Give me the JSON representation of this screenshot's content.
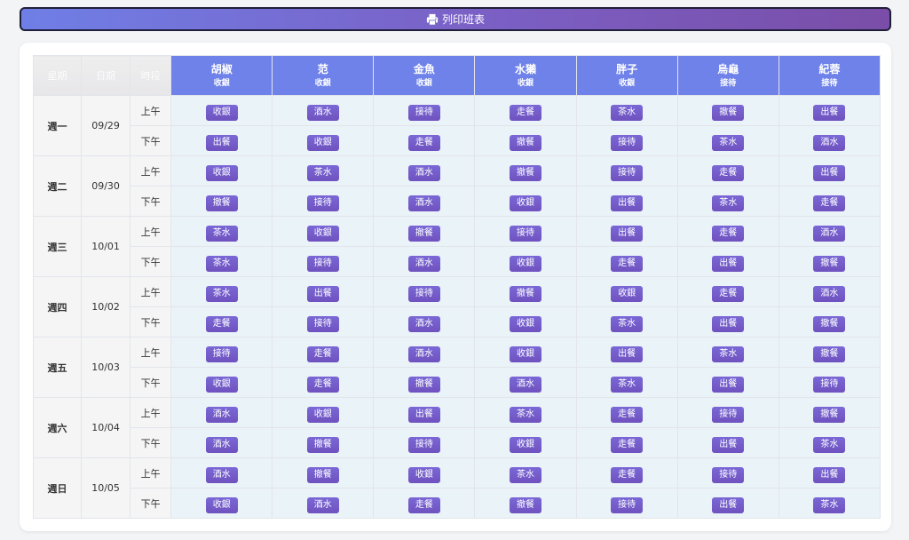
{
  "toolbar": {
    "print_label": "列印班表",
    "print_icon": "printer-icon"
  },
  "columns": {
    "day": "星期",
    "date": "日期",
    "period": "時段"
  },
  "employees": [
    {
      "name": "胡椒",
      "role": "收銀"
    },
    {
      "name": "范",
      "role": "收銀"
    },
    {
      "name": "金魚",
      "role": "收銀"
    },
    {
      "name": "水獺",
      "role": "收銀"
    },
    {
      "name": "胖子",
      "role": "收銀"
    },
    {
      "name": "烏龜",
      "role": "接待"
    },
    {
      "name": "紀蓉",
      "role": "接待"
    }
  ],
  "days": [
    {
      "day": "週一",
      "date": "09/29",
      "shifts": [
        {
          "period": "上午",
          "tasks": [
            "收銀",
            "酒水",
            "接待",
            "走餐",
            "茶水",
            "撤餐",
            "出餐"
          ]
        },
        {
          "period": "下午",
          "tasks": [
            "出餐",
            "收銀",
            "走餐",
            "撤餐",
            "接待",
            "茶水",
            "酒水"
          ]
        }
      ]
    },
    {
      "day": "週二",
      "date": "09/30",
      "shifts": [
        {
          "period": "上午",
          "tasks": [
            "收銀",
            "茶水",
            "酒水",
            "撤餐",
            "接待",
            "走餐",
            "出餐"
          ]
        },
        {
          "period": "下午",
          "tasks": [
            "撤餐",
            "接待",
            "酒水",
            "收銀",
            "出餐",
            "茶水",
            "走餐"
          ]
        }
      ]
    },
    {
      "day": "週三",
      "date": "10/01",
      "shifts": [
        {
          "period": "上午",
          "tasks": [
            "茶水",
            "收銀",
            "撤餐",
            "接待",
            "出餐",
            "走餐",
            "酒水"
          ]
        },
        {
          "period": "下午",
          "tasks": [
            "茶水",
            "接待",
            "酒水",
            "收銀",
            "走餐",
            "出餐",
            "撤餐"
          ]
        }
      ]
    },
    {
      "day": "週四",
      "date": "10/02",
      "shifts": [
        {
          "period": "上午",
          "tasks": [
            "茶水",
            "出餐",
            "接待",
            "撤餐",
            "收銀",
            "走餐",
            "酒水"
          ]
        },
        {
          "period": "下午",
          "tasks": [
            "走餐",
            "接待",
            "酒水",
            "收銀",
            "茶水",
            "出餐",
            "撤餐"
          ]
        }
      ]
    },
    {
      "day": "週五",
      "date": "10/03",
      "shifts": [
        {
          "period": "上午",
          "tasks": [
            "接待",
            "走餐",
            "酒水",
            "收銀",
            "出餐",
            "茶水",
            "撤餐"
          ]
        },
        {
          "period": "下午",
          "tasks": [
            "收銀",
            "走餐",
            "撤餐",
            "酒水",
            "茶水",
            "出餐",
            "接待"
          ]
        }
      ]
    },
    {
      "day": "週六",
      "date": "10/04",
      "shifts": [
        {
          "period": "上午",
          "tasks": [
            "酒水",
            "收銀",
            "出餐",
            "茶水",
            "走餐",
            "接待",
            "撤餐"
          ]
        },
        {
          "period": "下午",
          "tasks": [
            "酒水",
            "撤餐",
            "接待",
            "收銀",
            "走餐",
            "出餐",
            "茶水"
          ]
        }
      ]
    },
    {
      "day": "週日",
      "date": "10/05",
      "shifts": [
        {
          "period": "上午",
          "tasks": [
            "酒水",
            "撤餐",
            "收銀",
            "茶水",
            "走餐",
            "接待",
            "出餐"
          ]
        },
        {
          "period": "下午",
          "tasks": [
            "收銀",
            "酒水",
            "走餐",
            "撤餐",
            "接待",
            "出餐",
            "茶水"
          ]
        }
      ]
    }
  ]
}
